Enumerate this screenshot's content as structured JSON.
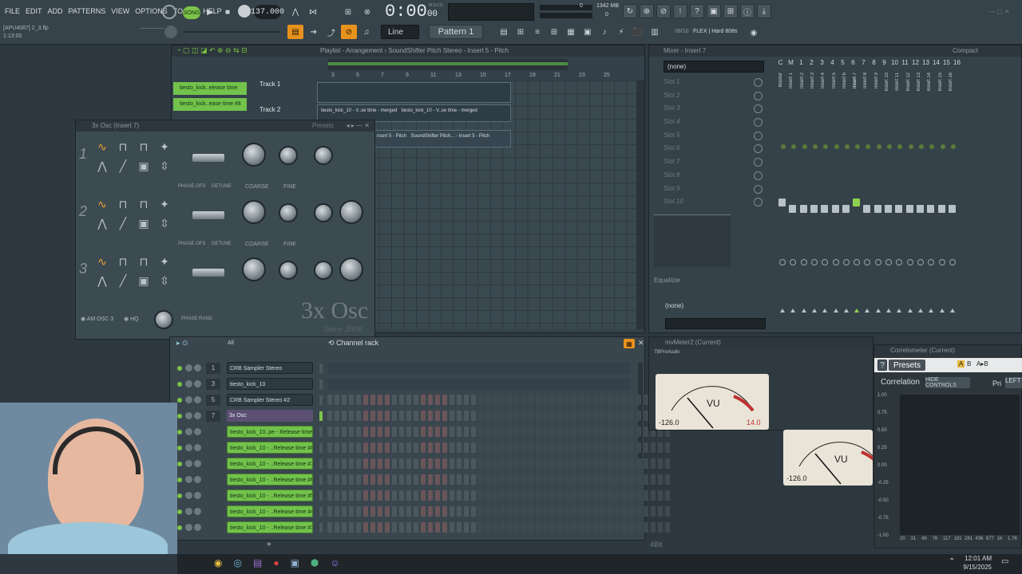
{
  "menu": [
    "FILE",
    "EDIT",
    "ADD",
    "PATTERNS",
    "VIEW",
    "OPTIONS",
    "TOOLS",
    "HELP"
  ],
  "project": {
    "name": "[APU4087] 2_3.flp",
    "position": "1:13:00"
  },
  "transport": {
    "song_label": "SONG",
    "tempo": "137.000",
    "time": "0:00",
    "time_sub": "00",
    "time_label": "M:S:CS",
    "cpu_mem": "1342 MB",
    "cpu_num": "0",
    "cpu_num2": "0"
  },
  "toolbar": {
    "snap": "Line",
    "pattern": "Pattern 1",
    "hint_counter": "08/10",
    "browser_info": "FLEX | Hard 808s"
  },
  "playlist": {
    "title": "Playlist - Arrangement › SoundShifter Pitch Stereo - Insert 5 - Pitch",
    "pattern_list": [
      "tiesto_kick..elease time",
      "tiesto_kick..ease time #8"
    ],
    "tracks": [
      "Track 1",
      "Track 2"
    ],
    "ruler": [
      "3",
      "5",
      "7",
      "9",
      "11",
      "13",
      "15",
      "17",
      "19",
      "21",
      "23",
      "25"
    ],
    "clip_labels": [
      "tiesto_kick_10 - V..se time - merged",
      "tiesto_kick_10 - V..se time - merged",
      "nsert 5 - Pitch",
      "SoundShifter Pitch... - Insert 5 - Pitch"
    ]
  },
  "osc": {
    "title": "3x Osc (Insert 7)",
    "presets": "Presets",
    "rows": [
      "1",
      "2",
      "3"
    ],
    "labels": {
      "phase_ofs": "PHASE OFS",
      "detune": "DETUNE",
      "coarse": "COARSE",
      "fine": "FINE",
      "am": "AM OSC 3",
      "hq": "HQ",
      "phase_rand": "PHASE RAND"
    },
    "brand": "3x Osc",
    "since": "Since 2000"
  },
  "mixer": {
    "title": "Mixer - Insert 7",
    "compact": "Compact",
    "preset": "(none)",
    "slots": [
      "Slot 1",
      "Slot 2",
      "Slot 3",
      "Slot 4",
      "Slot 5",
      "Slot 6",
      "Slot 7",
      "Slot 8",
      "Slot 9",
      "Slot 10"
    ],
    "equalizer": "Equalizer",
    "bottom_none": "(none)",
    "top_cols": [
      "C",
      "M",
      "1",
      "2",
      "3",
      "4",
      "5",
      "6",
      "7",
      "8",
      "9",
      "10",
      "11",
      "12",
      "13",
      "14",
      "15",
      "16"
    ],
    "strips": [
      "Master",
      "Insert 1",
      "Insert 2",
      "Insert 3",
      "Insert 4",
      "Insert 5",
      "Insert 6",
      "Insert 7",
      "Insert 8",
      "Insert 9",
      "Insert 10",
      "Insert 11",
      "Insert 12",
      "Insert 13",
      "Insert 14",
      "Insert 15",
      "Insert 16"
    ]
  },
  "channel_rack": {
    "title": "Channel rack",
    "filter": "All",
    "channels": [
      {
        "num": "1",
        "name": "CRB Sampler Stereo",
        "style": "grey"
      },
      {
        "num": "3",
        "name": "tiesto_kick_10",
        "style": "grey"
      },
      {
        "num": "5",
        "name": "CRB Sampler Stereo #2",
        "style": "grey"
      },
      {
        "num": "7",
        "name": "3x Osc",
        "style": "sel"
      },
      {
        "num": "",
        "name": "tiesto_kick_10..pe - Release time",
        "style": "green"
      },
      {
        "num": "",
        "name": "tiesto_kick_10 - ..Release time #8",
        "style": "green"
      },
      {
        "num": "",
        "name": "tiesto_kick_10 - ..Release time #7",
        "style": "green"
      },
      {
        "num": "",
        "name": "tiesto_kick_10 - ..Release time #6",
        "style": "green"
      },
      {
        "num": "",
        "name": "tiesto_kick_10 - ..Release time #5",
        "style": "green"
      },
      {
        "num": "",
        "name": "tiesto_kick_10 - ..Release time #4",
        "style": "green"
      },
      {
        "num": "",
        "name": "tiesto_kick_10 - ..Release time #3",
        "style": "green"
      }
    ]
  },
  "meter": {
    "title": "mvMeter2 (Current)",
    "brand": "TBProAudio",
    "left_value": "-126.0",
    "left_peak": "14.0",
    "right_value": "-126.0",
    "vu": "VU",
    "bit_label": "4Bit"
  },
  "correlometer": {
    "title": "Correlometer (Current)",
    "presets": "Presets",
    "correlation": "Correlation",
    "hide_controls": "HIDE CONTROLS",
    "pri": "Pri",
    "left": "LEFT",
    "a": "A",
    "b": "B",
    "ab": "A▸B",
    "y_ticks": [
      "1.00",
      "0.75",
      "0.50",
      "0.25",
      "0.00",
      "-0.25",
      "-0.50",
      "-0.75",
      "-1.00"
    ],
    "x_ticks": [
      "20",
      "31",
      "49",
      "76",
      "117",
      "181",
      "281",
      "436",
      "677",
      "1K",
      "1.7K"
    ]
  },
  "taskbar": {
    "time": "12:01 AM",
    "date": "9/15/2025"
  }
}
